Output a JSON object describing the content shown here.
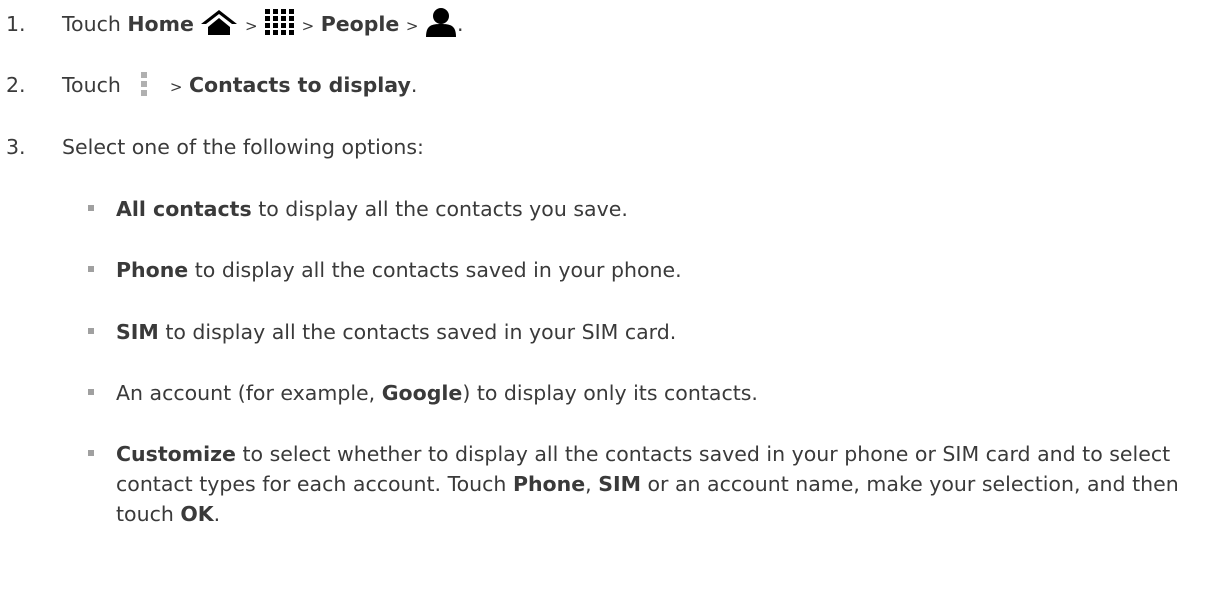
{
  "steps": [
    {
      "num": "1.",
      "touch": "Touch",
      "home": "Home",
      "sep": ">",
      "people": "People",
      "end": "."
    },
    {
      "num": "2.",
      "touch": "Touch",
      "sep": ">",
      "target": "Contacts to display",
      "end": "."
    },
    {
      "num": "3.",
      "text": "Select one of the following options:"
    }
  ],
  "options": [
    {
      "bold": "All contacts",
      "rest": " to display all the contacts you save."
    },
    {
      "bold": "Phone",
      "rest": " to display all the contacts saved in your phone."
    },
    {
      "bold": "SIM",
      "rest": " to display all the contacts saved in your SIM card."
    },
    {
      "pre": "An account (for example, ",
      "bold": "Google",
      "rest": ") to display only its contacts."
    }
  ],
  "customize": {
    "bold": "Customize",
    "t1": " to select whether to display all the contacts saved in your phone or SIM card and to select contact types for each account. Touch ",
    "b2": "Phone",
    "t2": ", ",
    "b3": "SIM",
    "t3": " or an account name, make your selection, and then touch ",
    "b4": "OK",
    "t4": "."
  },
  "icons": [
    "home-icon",
    "apps-grid-icon",
    "person-icon",
    "menu-dots-icon"
  ],
  "colors": {
    "text": "#3a3a3a",
    "icon": "#000000",
    "bullet": "#a0a0a0",
    "menu_dots": "#b0b0b0"
  }
}
